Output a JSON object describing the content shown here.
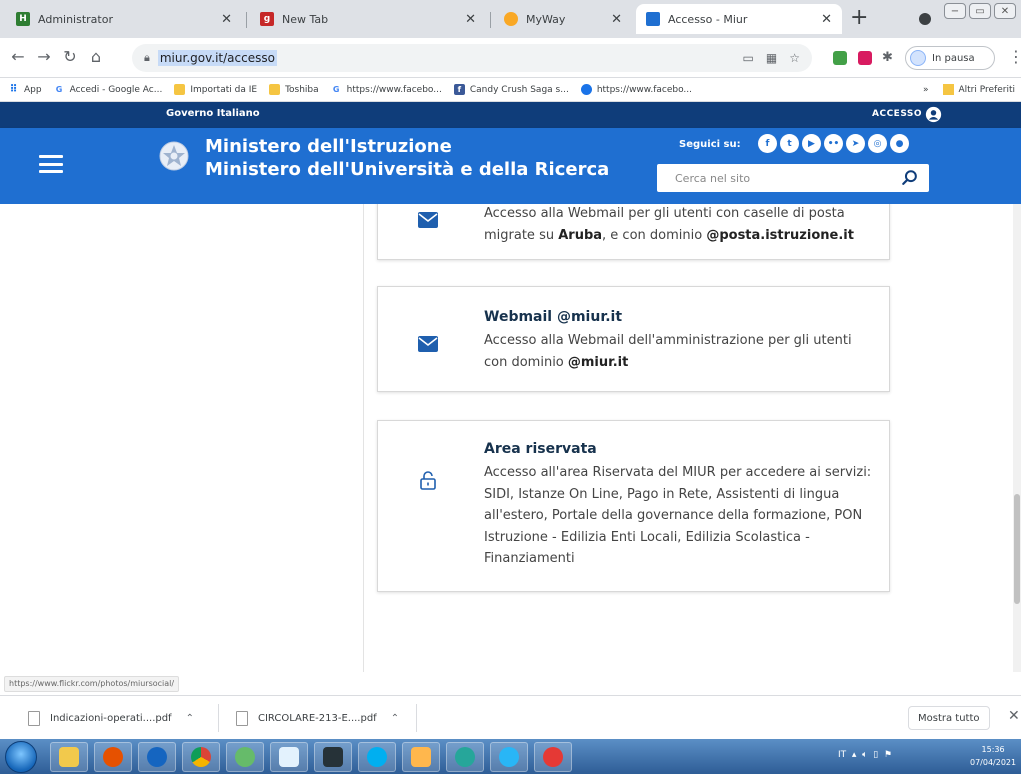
{
  "tabs": [
    {
      "label": "Administrator",
      "icon": "admin-favicon",
      "active": false
    },
    {
      "label": "New Tab",
      "icon": "newtab-favicon",
      "active": false
    },
    {
      "label": "MyWay",
      "icon": "myway-favicon",
      "active": false
    },
    {
      "label": "Accesso - Miur",
      "icon": "miur-favicon",
      "active": true
    }
  ],
  "address_bar": {
    "url": "miur.gov.it/accesso"
  },
  "profile": {
    "status": "In pausa"
  },
  "bookmarks": [
    {
      "label": "App",
      "icon": "apps-grid-icon"
    },
    {
      "label": "Accedi - Google Ac...",
      "icon": "google-icon"
    },
    {
      "label": "Importati da IE",
      "icon": "folder-icon"
    },
    {
      "label": "Toshiba",
      "icon": "folder-icon"
    },
    {
      "label": "https://www.facebo...",
      "icon": "google-icon"
    },
    {
      "label": "Candy Crush Saga s...",
      "icon": "facebook-icon"
    },
    {
      "label": "https://www.facebo...",
      "icon": "globe-icon"
    }
  ],
  "bookmarks_overflow": "»",
  "other_bookmarks": "Altri Preferiti",
  "site": {
    "gov_label": "Governo Italiano",
    "access_label": "ACCESSO",
    "ministry_line1": "Ministero dell'Istruzione",
    "ministry_line2": "Ministero dell'Università e della Ricerca",
    "follow_label": "Seguici su:",
    "socials": [
      "facebook",
      "twitter",
      "youtube",
      "flickr",
      "telegram",
      "instagram",
      "github"
    ],
    "search_placeholder": "Cerca nel sito"
  },
  "cards": [
    {
      "title": "",
      "icon": "envelope-icon",
      "desc_parts": [
        {
          "text": "Accesso alla Webmail per gli utenti con caselle di posta migrate su ",
          "bold": false
        },
        {
          "text": "Aruba",
          "bold": true
        },
        {
          "text": ", e con dominio ",
          "bold": false
        },
        {
          "text": "@posta.istruzione.it",
          "bold": true
        }
      ]
    },
    {
      "title": "Webmail @miur.it",
      "icon": "envelope-icon",
      "desc_parts": [
        {
          "text": "Accesso alla Webmail dell'amministrazione per gli utenti con dominio ",
          "bold": false
        },
        {
          "text": "@miur.it",
          "bold": true
        }
      ]
    },
    {
      "title": "Area riservata",
      "icon": "lock-icon",
      "desc_parts": [
        {
          "text": "Accesso all'area Riservata del MIUR per accedere ai servizi: SIDI, Istanze On Line, Pago in Rete, Assistenti di lingua all'estero, Portale della governance della formazione, PON Istruzione - Edilizia Enti Locali, Edilizia Scolastica - Finanziamenti",
          "bold": false
        }
      ]
    }
  ],
  "status_url": "https://www.flickr.com/photos/miursocial/",
  "downloads": [
    {
      "name": "Indicazioni-operati....pdf"
    },
    {
      "name": "CIRCOLARE-213-E....pdf"
    }
  ],
  "show_all_label": "Mostra tutto",
  "taskbar": {
    "apps": [
      "explorer",
      "firefox",
      "player",
      "chrome",
      "green-app",
      "paint",
      "media-center",
      "skype",
      "outlook",
      "edge",
      "ie",
      "security"
    ]
  },
  "clock": {
    "time": "15:36",
    "date": "07/04/2021"
  },
  "colors": {
    "gov_bar": "#0f3d7a",
    "site_header": "#1f6fd1",
    "card_title": "#17324d",
    "icon_blue": "#1f5fae"
  }
}
